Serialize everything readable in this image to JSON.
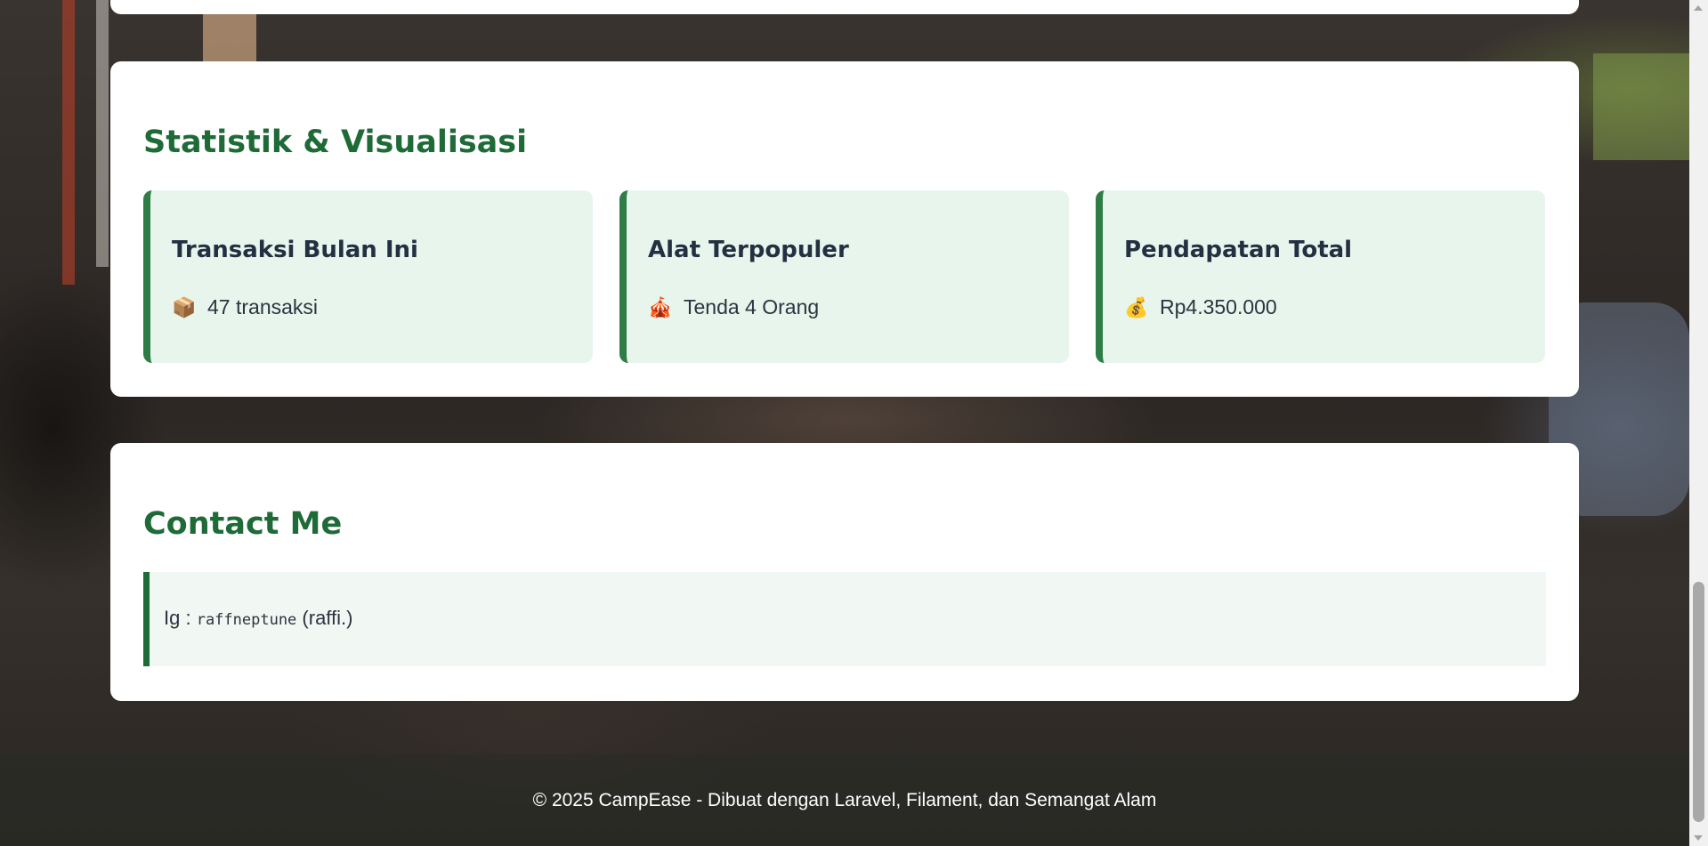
{
  "stats_section": {
    "title": "Statistik & Visualisasi",
    "cards": [
      {
        "title": "Transaksi Bulan Ini",
        "icon": "📦",
        "icon_name": "package-icon",
        "value": "47 transaksi"
      },
      {
        "title": "Alat Terpopuler",
        "icon": "🎪",
        "icon_name": "tent-icon",
        "value": "Tenda 4 Orang"
      },
      {
        "title": "Pendapatan Total",
        "icon": "💰",
        "icon_name": "money-bag-icon",
        "value": "Rp4.350.000"
      }
    ]
  },
  "contact_section": {
    "title": "Contact Me",
    "prefix": "Ig :",
    "handle": "raffneptune",
    "suffix": "(raffi.)"
  },
  "footer": {
    "text": "© 2025 CampEase - Dibuat dengan Laravel, Filament, dan Semangat Alam"
  },
  "colors": {
    "accent": "#1e6b37",
    "card_bg": "#e8f5ec",
    "contact_bg": "#f1f7f3"
  }
}
